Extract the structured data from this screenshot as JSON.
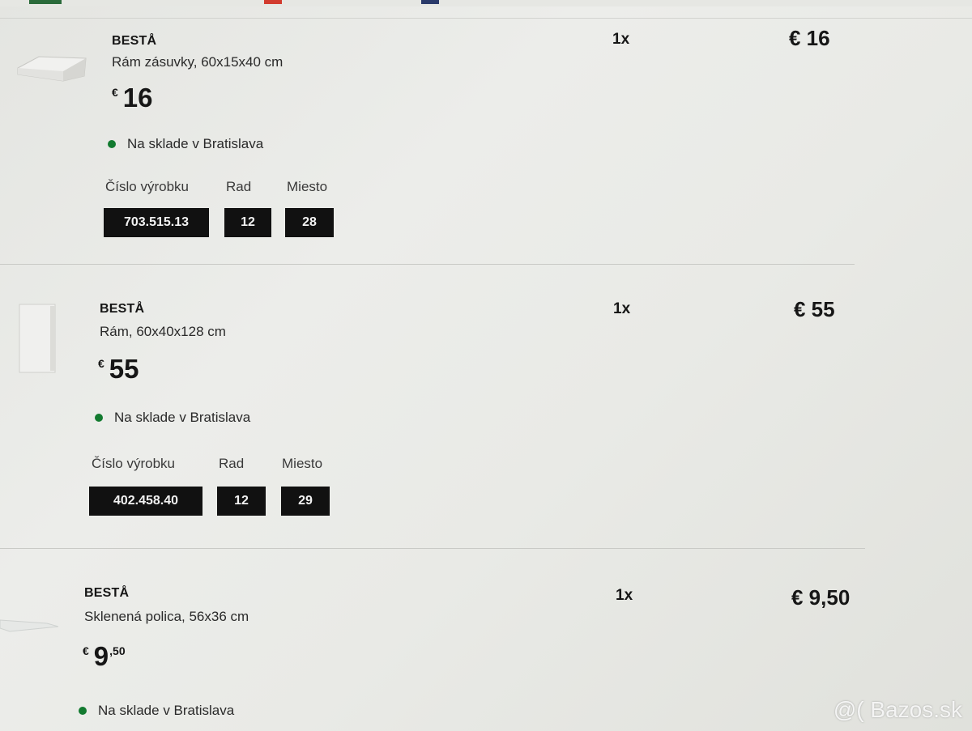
{
  "items": [
    {
      "brand": "BESTÅ",
      "description": "Rám zásuvky, 60x15x40 cm",
      "price": {
        "currency": "€",
        "integer": "16",
        "decimal": ""
      },
      "stock": "Na sklade v Bratislava",
      "labels": {
        "article": "Číslo výrobku",
        "aisle": "Rad",
        "location": "Miesto"
      },
      "article_number": "703.515.13",
      "aisle": "12",
      "location": "28",
      "quantity": "1x",
      "total": "€ 16"
    },
    {
      "brand": "BESTÅ",
      "description": "Rám, 60x40x128 cm",
      "price": {
        "currency": "€",
        "integer": "55",
        "decimal": ""
      },
      "stock": "Na sklade v Bratislava",
      "labels": {
        "article": "Číslo výrobku",
        "aisle": "Rad",
        "location": "Miesto"
      },
      "article_number": "402.458.40",
      "aisle": "12",
      "location": "29",
      "quantity": "1x",
      "total": "€ 55"
    },
    {
      "brand": "BESTÅ",
      "description": "Sklenená polica, 56x36 cm",
      "price": {
        "currency": "€",
        "integer": "9",
        "decimal": ",50"
      },
      "stock": "Na sklade v Bratislava",
      "quantity": "1x",
      "total": "€ 9,50"
    }
  ],
  "watermark": "@( Bazos.sk",
  "colors": {
    "stock_dot": "#127a2f",
    "badge_bg": "#111111",
    "badge_text": "#f2f2f2"
  }
}
